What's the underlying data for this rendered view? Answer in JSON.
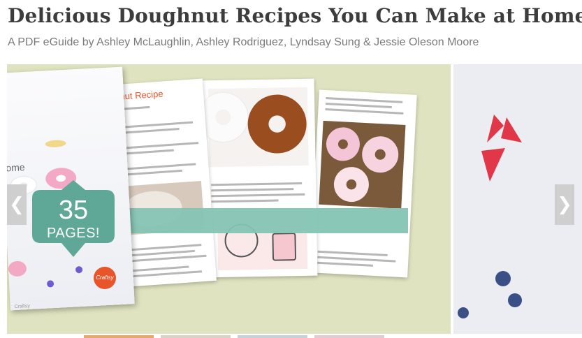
{
  "header": {
    "title": "Delicious Doughnut Recipes You Can Make at Home",
    "subtitle": "A PDF eGuide by Ashley McLaughlin, Ashley Rodriguez, Lyndsay Sung & Jessie Oleson Moore"
  },
  "carousel": {
    "prev_icon": "chevron-left-icon",
    "next_icon": "chevron-right-icon",
    "prev_glyph": "❮",
    "next_glyph": "❯",
    "badge": {
      "number": "35",
      "word": "PAGES!"
    },
    "cover": {
      "partial_title": "ome",
      "footer": "Craftsy"
    },
    "recipe_page": {
      "heading": "Doughnut Recipe"
    },
    "logo_text": "Craftsy"
  },
  "colors": {
    "slide_background": "#dfe3bf",
    "badge": "#5fa796",
    "ribbon": "#85c4b3",
    "accent_orange": "#e8552b",
    "strawberry": "#e03848",
    "blueberry": "#3a4f86"
  }
}
